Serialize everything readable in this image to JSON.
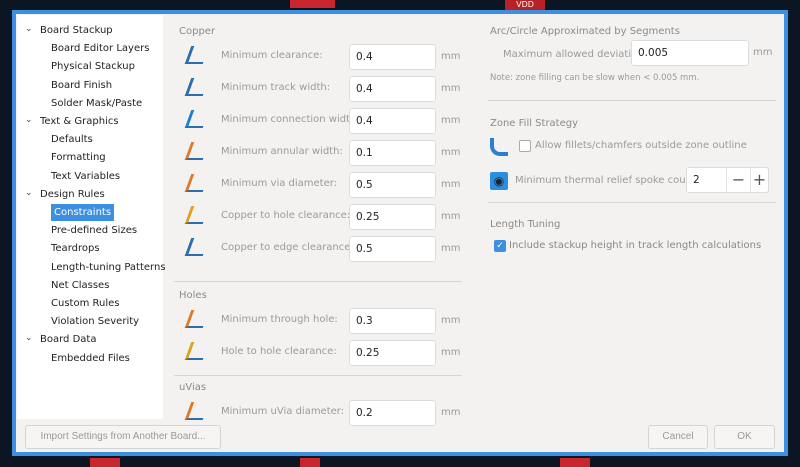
{
  "sidebar": {
    "items": [
      {
        "label": "Board Stackup",
        "level": 0
      },
      {
        "label": "Board Editor Layers",
        "level": 1
      },
      {
        "label": "Physical Stackup",
        "level": 1
      },
      {
        "label": "Board Finish",
        "level": 1
      },
      {
        "label": "Solder Mask/Paste",
        "level": 1
      },
      {
        "label": "Text & Graphics",
        "level": 0
      },
      {
        "label": "Defaults",
        "level": 1
      },
      {
        "label": "Formatting",
        "level": 1
      },
      {
        "label": "Text Variables",
        "level": 1
      },
      {
        "label": "Design Rules",
        "level": 0
      },
      {
        "label": "Constraints",
        "level": 1,
        "selected": true
      },
      {
        "label": "Pre-defined Sizes",
        "level": 1
      },
      {
        "label": "Teardrops",
        "level": 1
      },
      {
        "label": "Length-tuning Patterns",
        "level": 1
      },
      {
        "label": "Net Classes",
        "level": 1
      },
      {
        "label": "Custom Rules",
        "level": 1
      },
      {
        "label": "Violation Severity",
        "level": 1
      },
      {
        "label": "Board Data",
        "level": 0
      },
      {
        "label": "Embedded Files",
        "level": 1
      }
    ]
  },
  "copper": {
    "header": "Copper",
    "rows": [
      {
        "label": "Minimum clearance:",
        "value": "0.4",
        "unit": "mm"
      },
      {
        "label": "Minimum track width:",
        "value": "0.4",
        "unit": "mm"
      },
      {
        "label": "Minimum connection width:",
        "value": "0.4",
        "unit": "mm"
      },
      {
        "label": "Minimum annular width:",
        "value": "0.1",
        "unit": "mm"
      },
      {
        "label": "Minimum via diameter:",
        "value": "0.5",
        "unit": "mm"
      },
      {
        "label": "Copper to hole clearance:",
        "value": "0.25",
        "unit": "mm"
      },
      {
        "label": "Copper to edge clearance:",
        "value": "0.5",
        "unit": "mm"
      }
    ]
  },
  "holes": {
    "header": "Holes",
    "rows": [
      {
        "label": "Minimum through hole:",
        "value": "0.3",
        "unit": "mm"
      },
      {
        "label": "Hole to hole clearance:",
        "value": "0.25",
        "unit": "mm"
      }
    ]
  },
  "uvias": {
    "header": "uVias",
    "rows": [
      {
        "label": "Minimum uVia diameter:",
        "value": "0.2",
        "unit": "mm"
      }
    ]
  },
  "arc": {
    "header": "Arc/Circle Approximated by Segments",
    "label": "Maximum allowed deviation:",
    "value": "0.005",
    "unit": "mm",
    "note": "Note: zone filling can be slow when < 0.005 mm."
  },
  "zone": {
    "header": "Zone Fill Strategy",
    "fillets_label": "Allow fillets/chamfers outside zone outline",
    "fillets_checked": false,
    "spoke_label": "Minimum thermal relief spoke count:",
    "spoke_value": "2",
    "minus": "−",
    "plus": "+"
  },
  "length": {
    "header": "Length Tuning",
    "stackup_label": "Include stackup height in track length calculations",
    "stackup_checked": true
  },
  "buttons": {
    "import": "Import Settings from Another Board...",
    "cancel": "Cancel",
    "ok": "OK"
  },
  "background": {
    "text": "VDD"
  }
}
